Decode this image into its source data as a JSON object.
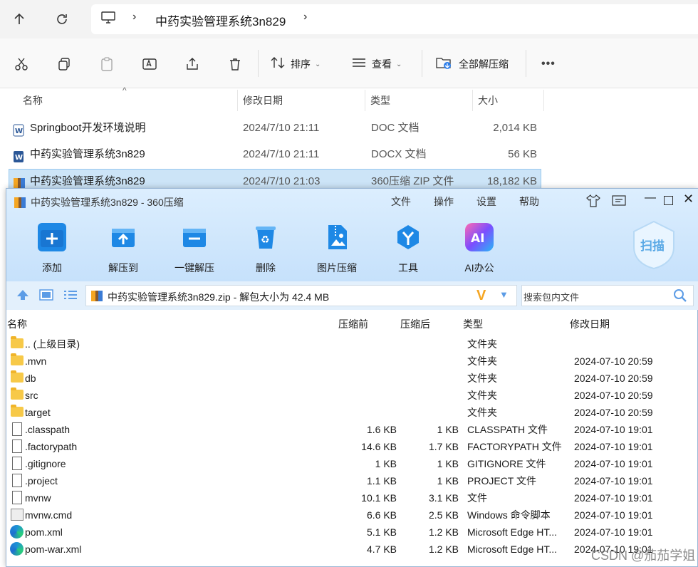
{
  "explorer": {
    "address": {
      "computer_icon": "monitor-icon",
      "path": "中药实验管理系统3n829"
    },
    "toolbar": {
      "sort": "排序",
      "view": "查看",
      "extract_all": "全部解压缩",
      "more": "•••"
    },
    "columns": {
      "name": "名称",
      "modified": "修改日期",
      "type": "类型",
      "size": "大小"
    },
    "files": [
      {
        "name": "Springboot开发环境说明",
        "modified": "2024/7/10 21:11",
        "type": "DOC 文档",
        "size": "2,014 KB",
        "icon": "word-doc-icon"
      },
      {
        "name": "中药实验管理系统3n829",
        "modified": "2024/7/10 21:11",
        "type": "DOCX 文档",
        "size": "56 KB",
        "icon": "word-doc-icon"
      },
      {
        "name": "中药实验管理系统3n829",
        "modified": "2024/7/10 21:03",
        "type": "360压缩 ZIP 文件",
        "size": "18,182 KB",
        "icon": "zip-archive-icon"
      }
    ]
  },
  "zip": {
    "title": "中药实验管理系统3n829 - 360压缩",
    "menu": [
      "文件",
      "操作",
      "设置",
      "帮助"
    ],
    "scan_label": "扫描",
    "buttons": [
      "添加",
      "解压到",
      "一键解压",
      "删除",
      "图片压缩",
      "工具",
      "AI办公"
    ],
    "path_text": "中药实验管理系统3n829.zip - 解包大小为 42.4 MB",
    "search_placeholder": "搜索包内文件",
    "columns": {
      "name": "名称",
      "compressed_before": "压缩前",
      "compressed_after": "压缩后",
      "type": "类型",
      "modified": "修改日期"
    },
    "rows": [
      {
        "name": ".. (上级目录)",
        "before": "",
        "after": "",
        "type": "文件夹",
        "modified": "",
        "icon": "folder"
      },
      {
        "name": ".mvn",
        "before": "",
        "after": "",
        "type": "文件夹",
        "modified": "2024-07-10 20:59",
        "icon": "folder"
      },
      {
        "name": "db",
        "before": "",
        "after": "",
        "type": "文件夹",
        "modified": "2024-07-10 20:59",
        "icon": "folder"
      },
      {
        "name": "src",
        "before": "",
        "after": "",
        "type": "文件夹",
        "modified": "2024-07-10 20:59",
        "icon": "folder"
      },
      {
        "name": "target",
        "before": "",
        "after": "",
        "type": "文件夹",
        "modified": "2024-07-10 20:59",
        "icon": "folder"
      },
      {
        "name": ".classpath",
        "before": "1.6 KB",
        "after": "1 KB",
        "type": "CLASSPATH 文件",
        "modified": "2024-07-10 19:01",
        "icon": "doc"
      },
      {
        "name": ".factorypath",
        "before": "14.6 KB",
        "after": "1.7 KB",
        "type": "FACTORYPATH 文件",
        "modified": "2024-07-10 19:01",
        "icon": "doc"
      },
      {
        "name": ".gitignore",
        "before": "1 KB",
        "after": "1 KB",
        "type": "GITIGNORE 文件",
        "modified": "2024-07-10 19:01",
        "icon": "doc"
      },
      {
        "name": ".project",
        "before": "1.1 KB",
        "after": "1 KB",
        "type": "PROJECT 文件",
        "modified": "2024-07-10 19:01",
        "icon": "doc"
      },
      {
        "name": "mvnw",
        "before": "10.1 KB",
        "after": "3.1 KB",
        "type": "文件",
        "modified": "2024-07-10 19:01",
        "icon": "doc"
      },
      {
        "name": "mvnw.cmd",
        "before": "6.6 KB",
        "after": "2.5 KB",
        "type": "Windows 命令脚本",
        "modified": "2024-07-10 19:01",
        "icon": "cmd"
      },
      {
        "name": "pom.xml",
        "before": "5.1 KB",
        "after": "1.2 KB",
        "type": "Microsoft Edge HT...",
        "modified": "2024-07-10 19:01",
        "icon": "edge"
      },
      {
        "name": "pom-war.xml",
        "before": "4.7 KB",
        "after": "1.2 KB",
        "type": "Microsoft Edge HT...",
        "modified": "2024-07-10 19:01",
        "icon": "edge"
      }
    ]
  },
  "watermark": "CSDN @茄茄学姐"
}
